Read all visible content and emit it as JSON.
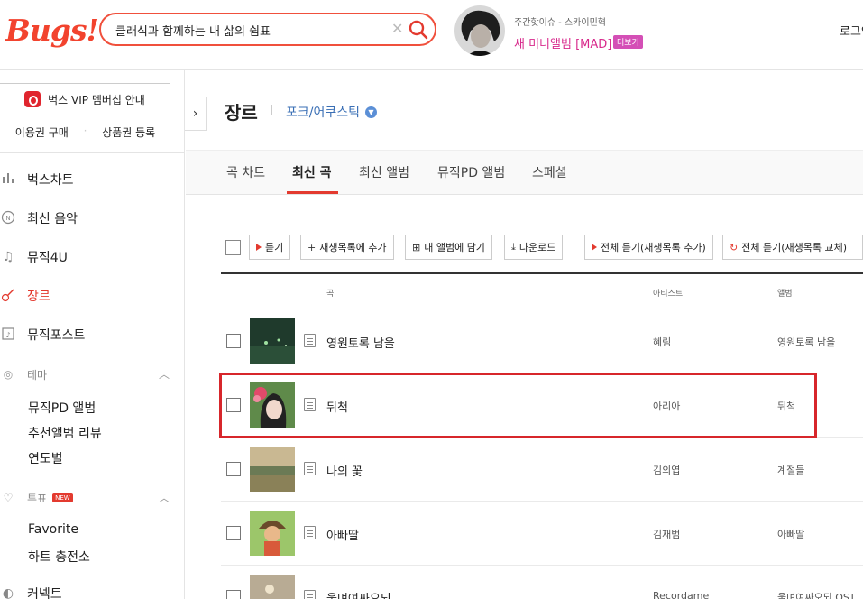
{
  "header": {
    "logo": "Bugs!",
    "search_value": "클래식과 함께하는 내 삶의 쉼표",
    "promo_subtitle": "주간핫이슈 - 스카이민혁",
    "promo_title": "새 미니앨범 [MAD]",
    "promo_more": "더보기",
    "login": "로그인"
  },
  "sidebar": {
    "vip_label": "벅스 VIP 멤버십 안내",
    "buy_label": "이용권 구매",
    "register_label": "상품권 등록",
    "nav": [
      {
        "label": "벅스차트",
        "icon": "chart-bars-icon"
      },
      {
        "label": "최신 음악",
        "icon": "new-music-icon"
      },
      {
        "label": "뮤직4U",
        "icon": "music-note-icon"
      },
      {
        "label": "장르",
        "icon": "guitar-icon"
      },
      {
        "label": "뮤직포스트",
        "icon": "music-post-icon"
      }
    ],
    "theme_section": "테마",
    "theme_items": [
      "뮤직PD 앨범",
      "추천앨범 리뷰",
      "연도별"
    ],
    "vote_section": "투표",
    "new_badge": "NEW",
    "vote_items": [
      "Favorite",
      "하트 충전소"
    ],
    "connect_label": "커넥트"
  },
  "main": {
    "title": "장르",
    "genre": "포크/어쿠스틱",
    "tabs": [
      "곡 차트",
      "최신 곡",
      "최신 앨범",
      "뮤직PD 앨범",
      "스페셜"
    ],
    "active_tab": "최신 곡",
    "toolbar": {
      "listen": "듣기",
      "add_playlist": "재생목록에 추가",
      "add_album": "내 앨범에 담기",
      "download": "다운로드",
      "play_all_add": "전체 듣기(재생목록 추가)",
      "play_all_replace": "전체 듣기(재생목록 교체)"
    },
    "columns": {
      "song": "곡",
      "artist": "아티스트",
      "album": "앨범"
    },
    "rows": [
      {
        "title": "영원토록 남을",
        "artist": "혜림",
        "album": "영원토록 남을"
      },
      {
        "title": "뒤척",
        "artist": "아리아",
        "album": "뒤척"
      },
      {
        "title": "나의 꽃",
        "artist": "김의엽",
        "album": "계절들"
      },
      {
        "title": "아빠딸",
        "artist": "김재범",
        "album": "아빠딸"
      },
      {
        "title": "울며여짜오되",
        "artist": "Recordame",
        "album": "울며여짜오되 OST"
      }
    ]
  },
  "colors": {
    "brand": "#f2432e",
    "accent": "#e33a2f",
    "link": "#3a6fb5",
    "highlight": "#d7262b"
  }
}
